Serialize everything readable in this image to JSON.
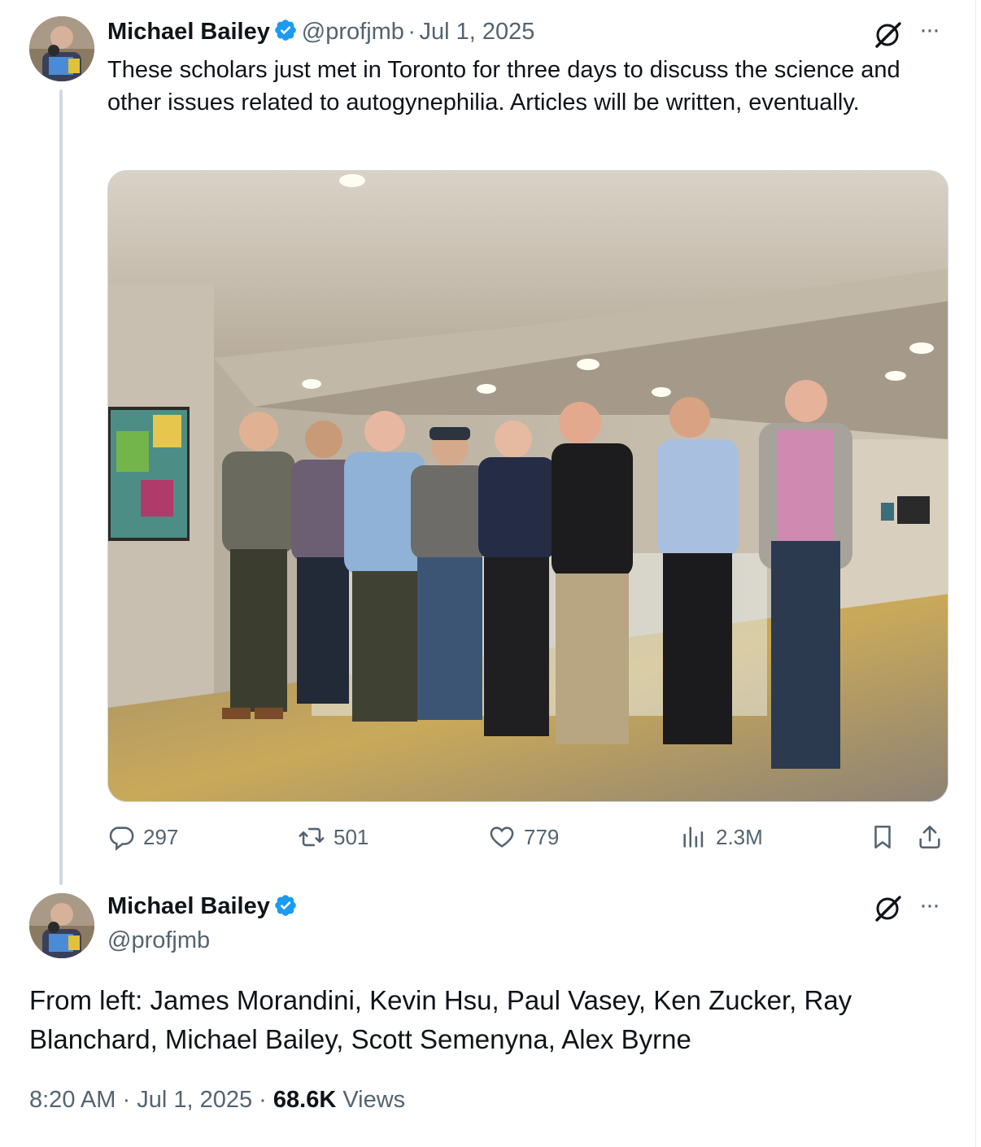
{
  "tweet": {
    "author_name": "Michael Bailey",
    "handle": "@profjmb",
    "separator": "·",
    "date": "Jul 1, 2025",
    "text": "These scholars just met in Toronto for three days to discuss the science and other issues related to autogynephilia. Articles will be written, eventually.",
    "more_label": "···",
    "actions": {
      "replies": "297",
      "reposts": "501",
      "likes": "779",
      "views": "2.3M"
    },
    "icons": [
      "grok-icon",
      "more-icon",
      "reply-icon",
      "repost-icon",
      "like-icon",
      "views-icon",
      "bookmark-icon",
      "share-icon",
      "verified-badge-icon"
    ]
  },
  "reply": {
    "author_name": "Michael Bailey",
    "handle": "@profjmb",
    "more_label": "···",
    "text": "From left: James Morandini, Kevin Hsu, Paul Vasey, Ken Zucker,  Ray Blanchard, Michael Bailey, Scott Semenyna, Alex Byrne",
    "time": "8:20 AM",
    "separator": "·",
    "date": "Jul 1, 2025",
    "views_count": "68.6K",
    "views_label": "Views"
  },
  "colors": {
    "verified_blue": "#1d9bf0",
    "muted_text": "#536471",
    "primary_text": "#0f1419",
    "thread_line": "#cfd9de"
  }
}
